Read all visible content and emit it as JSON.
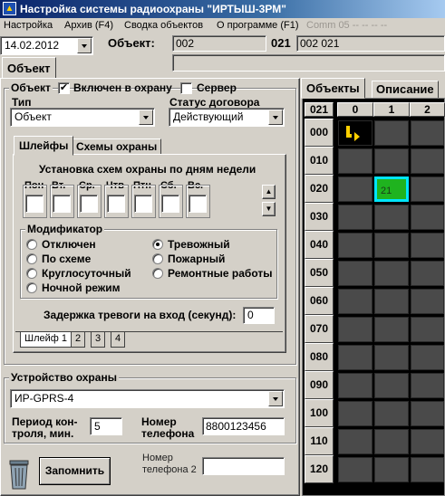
{
  "window": {
    "title": "Настройка системы радиоохраны \"ИРТЫШ-3РМ\""
  },
  "menu": {
    "items": [
      "Настройка",
      "Архив (F4)",
      "Сводка объектов",
      "О программе (F1)"
    ],
    "comm": "Comm 05 -- -- -- --"
  },
  "top": {
    "date": "14.02.2012",
    "object_label": "Объект:",
    "object_code": "002",
    "object_sub": "021",
    "object_full": "002 021"
  },
  "main_tab": "Объект",
  "object_group": {
    "title": "Объект",
    "enabled_label": "Включен в охрану",
    "enabled_checked": true,
    "server_label": "Сервер",
    "server_checked": false
  },
  "type": {
    "label": "Тип",
    "value": "Объект"
  },
  "contract": {
    "label": "Статус договора",
    "value": "Действующий"
  },
  "inner_tabs": [
    "Шлейфы",
    "Схемы охраны"
  ],
  "schedule": {
    "title": "Установка схем охраны по дням недели",
    "days": [
      "Пон",
      "Вт.",
      "Ср.",
      "Чтв",
      "Птн",
      "Сб.",
      "Вс."
    ]
  },
  "modifier": {
    "title": "Модификатор",
    "options_left": [
      "Отключен",
      "По схеме",
      "Круглосуточный",
      "Ночной режим"
    ],
    "options_right": [
      "Тревожный",
      "Пожарный",
      "Ремонтные работы"
    ],
    "selected": "Тревожный"
  },
  "delay": {
    "label": "Задержка тревоги на вход (секунд):",
    "value": "0"
  },
  "loop_tabs": [
    "Шлейф 1",
    "2",
    "3",
    "4"
  ],
  "device": {
    "title": "Устройство охраны",
    "value": "ИР-GPRS-4"
  },
  "period": {
    "label_line1": "Период кон-",
    "label_line2": "троля, мин.",
    "value": "5"
  },
  "phone": {
    "label_line1": "Номер",
    "label_line2": "телефона",
    "value": "8800123456"
  },
  "phone2": {
    "label_line1": "Номер",
    "label_line2": "телефона 2",
    "value": ""
  },
  "save_button": "Запомнить",
  "right_tabs": [
    "Объекты",
    "Описание"
  ],
  "objects_grid": {
    "corner": "021",
    "columns": [
      "0",
      "1",
      "2"
    ],
    "rows": [
      "000",
      "010",
      "020",
      "030",
      "040",
      "050",
      "060",
      "070",
      "080",
      "090",
      "100",
      "110",
      "120"
    ],
    "active_cell_label": "21",
    "colors": {
      "cell": "#4a4a4a",
      "active": "#1fb31f",
      "active_border": "#00e5ff",
      "grid_bg": "#000000",
      "marker": "#ffd000"
    }
  }
}
